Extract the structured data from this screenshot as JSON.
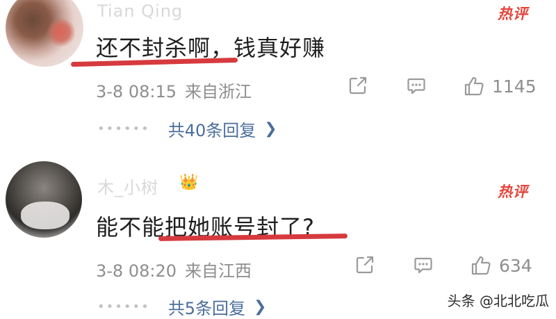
{
  "comments": [
    {
      "username": "Tian Qing",
      "hot_tag": "热评",
      "text": "还不封杀啊，钱真好赚",
      "date": "3-8 08:15",
      "location": "来自浙江",
      "likes": "1145",
      "replies": "共40条回复"
    },
    {
      "username": "木_小树",
      "hot_tag": "热评",
      "text": "能不能把她账号封了?",
      "date": "3-8 08:20",
      "location": "来自江西",
      "likes": "634",
      "replies": "共5条回复"
    }
  ],
  "icons": {
    "share": "share-icon",
    "comment": "comment-icon",
    "like": "thumbs-up-icon",
    "chevron": "chevron-right-icon"
  },
  "watermark": "头条 @北北吃瓜",
  "colors": {
    "hot": "#e5443a",
    "underline": "#d63a3f",
    "link": "#4a6d9c",
    "meta": "#8e8e8e"
  }
}
